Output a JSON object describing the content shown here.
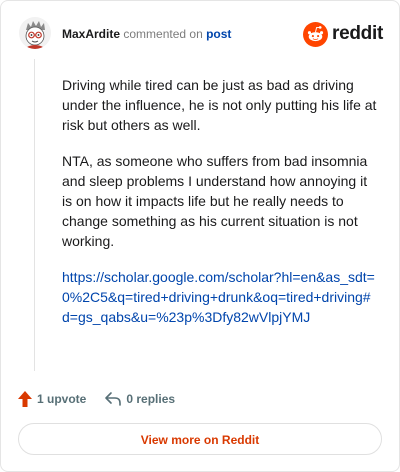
{
  "header": {
    "username": "MaxArdite",
    "commented_text": "commented on",
    "post_link": "post",
    "brand": "reddit"
  },
  "comment": {
    "paragraphs": [
      "Driving while tired can be just as bad as driving under the influence, he is not only putting his life at risk but others as well.",
      "NTA, as someone who suffers from bad insomnia and sleep problems I understand how annoying it is on how it impacts life but he really needs to change something as his current situation is not working."
    ],
    "link": "https://scholar.google.com/scholar?hl=en&as_sdt=0%2C5&q=tired+driving+drunk&oq=tired+driving#d=gs_qabs&u=%23p%3Dfy82wVlpjYMJ"
  },
  "actions": {
    "upvote_label": "1 upvote",
    "replies_label": "0 replies"
  },
  "footer": {
    "view_more_label": "View more on Reddit"
  },
  "colors": {
    "accent": "#d93900",
    "link": "#0045ac",
    "upvote": "#d93900"
  },
  "icons": {
    "upvote": "upvote-arrow-icon",
    "reply": "reply-arrow-icon",
    "brand": "reddit-snoo-icon"
  }
}
